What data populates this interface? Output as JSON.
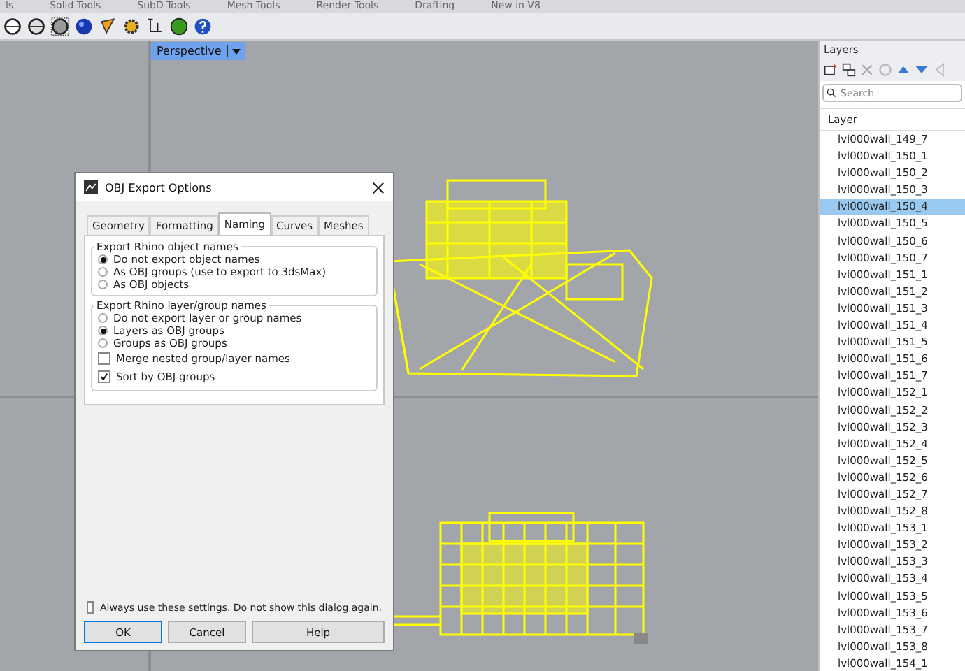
{
  "ribbon_tabs": [
    {
      "label": "ls"
    },
    {
      "label": "Solid Tools"
    },
    {
      "label": "SubD Tools"
    },
    {
      "label": "Mesh Tools"
    },
    {
      "label": "Render Tools"
    },
    {
      "label": "Drafting"
    },
    {
      "label": "New in V8"
    }
  ],
  "viewport": {
    "label": "Perspective"
  },
  "dialog": {
    "title": "OBJ Export Options",
    "tabs": [
      {
        "label": "Geometry",
        "selected": false
      },
      {
        "label": "Formatting",
        "selected": false
      },
      {
        "label": "Naming",
        "selected": true
      },
      {
        "label": "Curves",
        "selected": false
      },
      {
        "label": "Meshes",
        "selected": false
      }
    ],
    "groups": [
      {
        "title": "Export Rhino object names",
        "options": [
          {
            "kind": "radio",
            "label": "Do not export object names",
            "selected": true
          },
          {
            "kind": "radio",
            "label": "As OBJ groups (use to export to 3dsMax)",
            "selected": false
          },
          {
            "kind": "radio",
            "label": "As OBJ objects",
            "selected": false
          }
        ]
      },
      {
        "title": "Export Rhino layer/group names",
        "options": [
          {
            "kind": "radio",
            "label": "Do not export layer or group names",
            "selected": false
          },
          {
            "kind": "radio",
            "label": "Layers as OBJ groups",
            "selected": true
          },
          {
            "kind": "radio",
            "label": "Groups as OBJ groups",
            "selected": false
          },
          {
            "kind": "checkbox",
            "label": "Merge nested group/layer names",
            "checked": false
          },
          {
            "kind": "checkbox",
            "label": "Sort by OBJ groups",
            "checked": true
          }
        ]
      }
    ],
    "remember": {
      "label": "Always use these settings. Do not show this dialog again.",
      "checked": false
    },
    "buttons": [
      {
        "label": "OK",
        "default": true
      },
      {
        "label": "Cancel",
        "default": false
      },
      {
        "label": "Help",
        "default": false
      }
    ]
  },
  "layers_panel": {
    "title": "Layers",
    "search": {
      "placeholder": "Search"
    },
    "column": "Layer",
    "rows": [
      {
        "name": "lvl000wall_149_7",
        "selected": false
      },
      {
        "name": "lvl000wall_150_1",
        "selected": false
      },
      {
        "name": "lvl000wall_150_2",
        "selected": false
      },
      {
        "name": "lvl000wall_150_3",
        "selected": false
      },
      {
        "name": "lvl000wall_150_4",
        "selected": true
      },
      {
        "name": "lvl000wall_150_5",
        "selected": false
      },
      {
        "name": "lvl000wall_150_6",
        "selected": false
      },
      {
        "name": "lvl000wall_150_7",
        "selected": false
      },
      {
        "name": "lvl000wall_151_1",
        "selected": false
      },
      {
        "name": "lvl000wall_151_2",
        "selected": false
      },
      {
        "name": "lvl000wall_151_3",
        "selected": false
      },
      {
        "name": "lvl000wall_151_4",
        "selected": false
      },
      {
        "name": "lvl000wall_151_5",
        "selected": false
      },
      {
        "name": "lvl000wall_151_6",
        "selected": false
      },
      {
        "name": "lvl000wall_151_7",
        "selected": false
      },
      {
        "name": "lvl000wall_152_1",
        "selected": false
      },
      {
        "name": "lvl000wall_152_2",
        "selected": false
      },
      {
        "name": "lvl000wall_152_3",
        "selected": false
      },
      {
        "name": "lvl000wall_152_4",
        "selected": false
      },
      {
        "name": "lvl000wall_152_5",
        "selected": false
      },
      {
        "name": "lvl000wall_152_6",
        "selected": false
      },
      {
        "name": "lvl000wall_152_7",
        "selected": false
      },
      {
        "name": "lvl000wall_152_8",
        "selected": false
      },
      {
        "name": "lvl000wall_153_1",
        "selected": false
      },
      {
        "name": "lvl000wall_153_2",
        "selected": false
      },
      {
        "name": "lvl000wall_153_3",
        "selected": false
      },
      {
        "name": "lvl000wall_153_4",
        "selected": false
      },
      {
        "name": "lvl000wall_153_5",
        "selected": false
      },
      {
        "name": "lvl000wall_153_6",
        "selected": false
      },
      {
        "name": "lvl000wall_153_7",
        "selected": false
      },
      {
        "name": "lvl000wall_153_8",
        "selected": false
      },
      {
        "name": "lvl000wall_154_1",
        "selected": false
      }
    ]
  }
}
